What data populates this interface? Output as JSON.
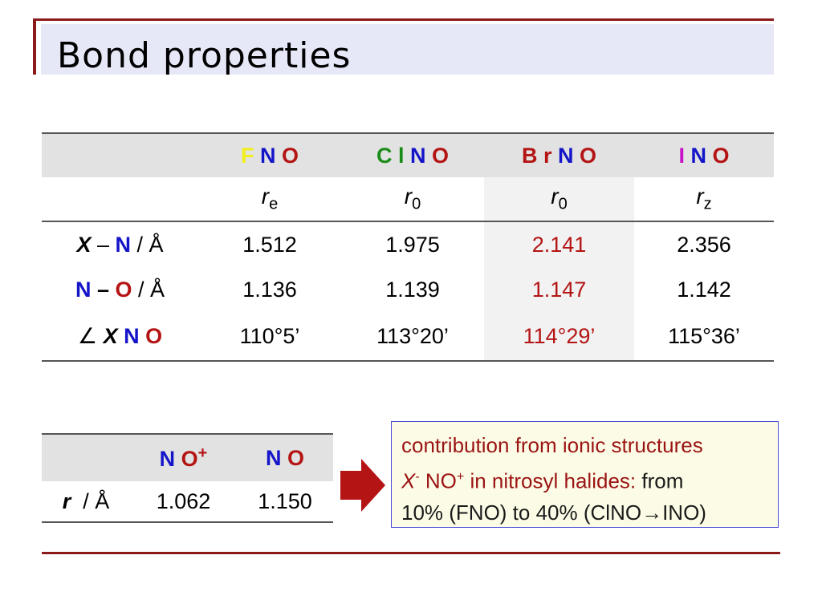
{
  "title": "Bond properties",
  "main_table": {
    "molecules": [
      {
        "letters": [
          "F",
          "N",
          "O"
        ]
      },
      {
        "letters": [
          "C l",
          "N",
          "O"
        ]
      },
      {
        "letters": [
          "B r",
          "N",
          "O"
        ]
      },
      {
        "letters": [
          "I",
          "N",
          "O"
        ]
      }
    ],
    "methods": [
      {
        "sym": "r",
        "sub": "e"
      },
      {
        "sym": "r",
        "sub": "0"
      },
      {
        "sym": "r",
        "sub": "0"
      },
      {
        "sym": "r",
        "sub": "z"
      }
    ],
    "rows": [
      {
        "label_parts": [
          "X",
          " – ",
          "N",
          " / Å"
        ],
        "values": [
          "1.512",
          "1.975",
          "2.141",
          "2.356"
        ]
      },
      {
        "label_parts": [
          "N",
          " – ",
          "O",
          " / Å"
        ],
        "values": [
          "1.136",
          "1.139",
          "1.147",
          "1.142"
        ]
      },
      {
        "label_parts": [
          "∠ ",
          "X",
          " N",
          " O"
        ],
        "values": [
          "110°5’",
          "113°20’",
          "114°29’",
          "115°36’"
        ]
      }
    ]
  },
  "small_table": {
    "headers": [
      {
        "base": "N O",
        "sup": "+"
      },
      {
        "base": "N O",
        "sup": ""
      }
    ],
    "row_label": {
      "sym": "r",
      "unit": "  / Å"
    },
    "values": [
      "1.062",
      "1.150"
    ]
  },
  "callout": {
    "line1": "contribution from ionic structures",
    "line2_x": "X",
    "line2_sup": "-",
    "line2_no": " NO",
    "line2_sup2": "+",
    "line2_mid": " in nitrosyl halides: ",
    "line2_end": "from",
    "line3": "10% (FNO) to 40% (ClNO",
    "line3_arrow": "→",
    "line3_end": "INO)"
  },
  "colors": {
    "accent": "#8b1a1a",
    "blue": "#1414c8",
    "red": "#b41414",
    "yellow": "#f2ef1a",
    "green": "#1a8c1a",
    "magenta": "#c814c8"
  }
}
